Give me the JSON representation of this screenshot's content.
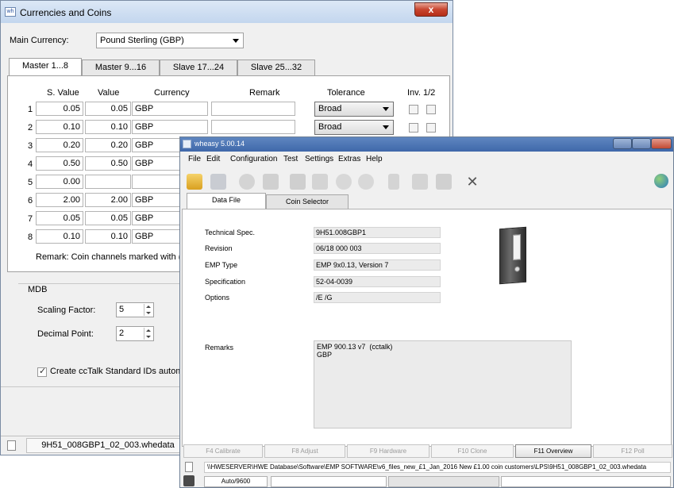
{
  "currencies_window": {
    "title": "Currencies and Coins",
    "close_label": "x",
    "main_currency_label": "Main Currency:",
    "main_currency_value": "Pound Sterling  (GBP)",
    "tabs": [
      {
        "label": "Master 1...8"
      },
      {
        "label": "Master 9...16"
      },
      {
        "label": "Slave 17...24"
      },
      {
        "label": "Slave 25...32"
      }
    ],
    "columns": {
      "s_value": "S. Value",
      "value": "Value",
      "currency": "Currency",
      "remark": "Remark",
      "tolerance": "Tolerance",
      "inv": "Inv. 1/2"
    },
    "rows": [
      {
        "no": "1",
        "s_value": "0.05",
        "value": "0.05",
        "currency": "GBP",
        "tolerance": "Broad"
      },
      {
        "no": "2",
        "s_value": "0.10",
        "value": "0.10",
        "currency": "GBP",
        "tolerance": "Broad"
      },
      {
        "no": "3",
        "s_value": "0.20",
        "value": "0.20",
        "currency": "GBP"
      },
      {
        "no": "4",
        "s_value": "0.50",
        "value": "0.50",
        "currency": "GBP"
      },
      {
        "no": "5",
        "s_value": "0.00",
        "value": "",
        "currency": ""
      },
      {
        "no": "6",
        "s_value": "2.00",
        "value": "2.00",
        "currency": "GBP"
      },
      {
        "no": "7",
        "s_value": "0.05",
        "value": "0.05",
        "currency": "GBP"
      },
      {
        "no": "8",
        "s_value": "0.10",
        "value": "0.10",
        "currency": "GBP"
      }
    ],
    "remark_note": "Remark: Coin channels marked with (*) require",
    "mdb_label": "MDB",
    "scaling_factor_label": "Scaling Factor:",
    "scaling_factor_value": "5",
    "decimal_point_label": "Decimal Point:",
    "decimal_point_value": "2",
    "cctalk_label": "Create ccTalk Standard IDs automatically",
    "status_file": "9H51_008GBP1_02_003.whedata"
  },
  "wheasy_window": {
    "title": "wheasy 5.00.14",
    "menu": [
      "File",
      "Edit",
      "Configuration",
      "Test",
      "Settings",
      "Extras",
      "Help"
    ],
    "tabs": [
      {
        "label": "Data File"
      },
      {
        "label": "Coin Selector"
      }
    ],
    "fields": [
      {
        "label": "Technical Spec.",
        "value": "9H51.008GBP1"
      },
      {
        "label": "Revision",
        "value": "06/18  000 003"
      },
      {
        "label": "EMP Type",
        "value": "EMP 9x0.13, Version 7"
      },
      {
        "label": "Specification",
        "value": "52-04-0039"
      },
      {
        "label": "Options",
        "value": "/E /G"
      }
    ],
    "remarks_label": "Remarks",
    "remarks_value": "EMP 900.13 v7  (cctalk)\nGBP",
    "fkeys": [
      {
        "label": "F4 Calibrate"
      },
      {
        "label": "F8 Adjust"
      },
      {
        "label": "F9 Hardware"
      },
      {
        "label": "F10 Clone"
      },
      {
        "label": "F11 Overview"
      },
      {
        "label": "F12 Poll"
      }
    ],
    "path": "\\\\HWESERVER\\HWE Database\\Software\\EMP SOFTWARE\\v6_files_new_£1_Jan_2016 New £1.00 coin customers\\LPS\\9H51_008GBP1_02_003.whedata",
    "port": "Auto/9600"
  },
  "colors": {
    "titlebar_back": "#c3d6ee",
    "titlebar_front": "#3f68aa",
    "close_button": "#c8452f"
  }
}
